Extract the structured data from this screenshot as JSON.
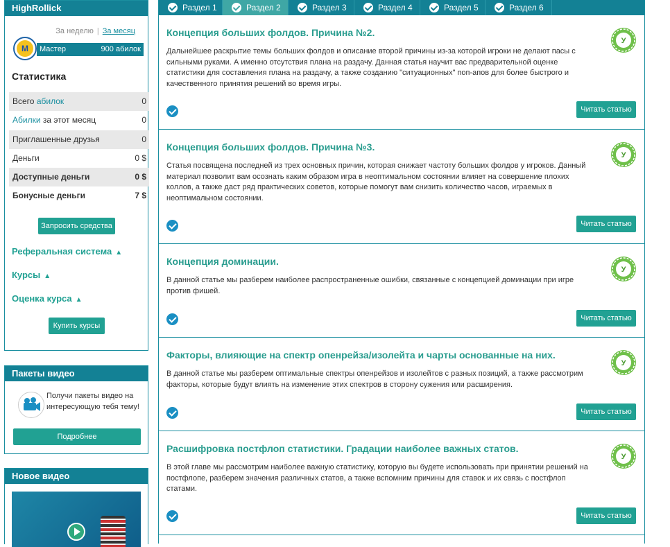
{
  "sidebar": {
    "profile": {
      "brand": "HighRollick",
      "period_week": "За неделю",
      "period_month": "За месяц",
      "rank_badge_letter": "M",
      "rank_name": "Мастер",
      "rank_value": "900 абилок",
      "stats_title": "Статистика",
      "stats": [
        {
          "label_pre": "Всего ",
          "label_link": "абилок",
          "label_post": "",
          "value": "0"
        },
        {
          "label_pre": "",
          "label_link": "Абилки",
          "label_post": " за этот месяц",
          "value": "0"
        },
        {
          "label_pre": "Приглашенные друзья",
          "label_link": "",
          "label_post": "",
          "value": "0"
        },
        {
          "label_pre": "Деньги",
          "label_link": "",
          "label_post": "",
          "value": "0 $"
        },
        {
          "label_pre": "Доступные деньги",
          "label_link": "",
          "label_post": "",
          "value": "0 $"
        },
        {
          "label_pre": "Бонусные деньги",
          "label_link": "",
          "label_post": "",
          "value": "7 $"
        }
      ],
      "request_funds": "Запросить средства",
      "referral": "Реферальная система",
      "courses": "Курсы",
      "course_rating": "Оценка курса",
      "buy_courses": "Купить курсы"
    },
    "video_packs": {
      "title": "Пакеты видео",
      "text": "Получи пакеты видео на интересующую тебя тему!",
      "more": "Подробнее"
    },
    "new_video": {
      "title": "Новое видео"
    }
  },
  "tabs": [
    "Раздел 1",
    "Раздел 2",
    "Раздел 3",
    "Раздел 4",
    "Раздел 5",
    "Раздел 6"
  ],
  "active_tab": 1,
  "seal_letter": "У",
  "read_label": "Читать статью",
  "articles": [
    {
      "title": "Концепция больших фолдов. Причина №2.",
      "desc": "Дальнейшее раскрытие темы больших фолдов и описание второй причины из-за которой игроки не делают пасы с сильными руками. А именно отсутствия плана на раздачу. Данная статья научит вас предварительной оценке статистики для составления плана на раздачу, а также созданию \"ситуационных\" поп-апов для более быстрого и качественного принятия решений во время игры."
    },
    {
      "title": "Концепция больших фолдов. Причина №3.",
      "desc": "Статья посвящена последней из трех основных причин, которая снижает частоту больших фолдов у игроков. Данный материал позволит вам осознать каким образом игра в неоптимальном состоянии влияет на совершение плохих коллов, а также даст ряд практических советов, которые помогут вам снизить количество часов, играемых в неоптимальном состоянии."
    },
    {
      "title": "Концепция доминации.",
      "desc": "В данной статье мы разберем наиболее распространенные ошибки, связанные с концепцией доминации при игре против фишей."
    },
    {
      "title": "Факторы, влияющие на спектр опенрейза/изолейта и чарты основанные на них.",
      "desc": "В данной статье мы разберем оптимальные спектры опенрейзов и изолейтов с разных позиций, а также рассмотрим факторы, которые будут влиять на изменение этих спектров в сторону сужения или расширения."
    },
    {
      "title": "Расшифровка постфлоп статистики. Градации наиболее важных статов.",
      "desc": "В этой главе мы рассмотрим наиболее важную статистику, которую вы будете использовать при принятии решений на постфлопе, разберем значения различных статов, а также вспомним причины для ставок и их связь с постфлоп статами."
    }
  ]
}
